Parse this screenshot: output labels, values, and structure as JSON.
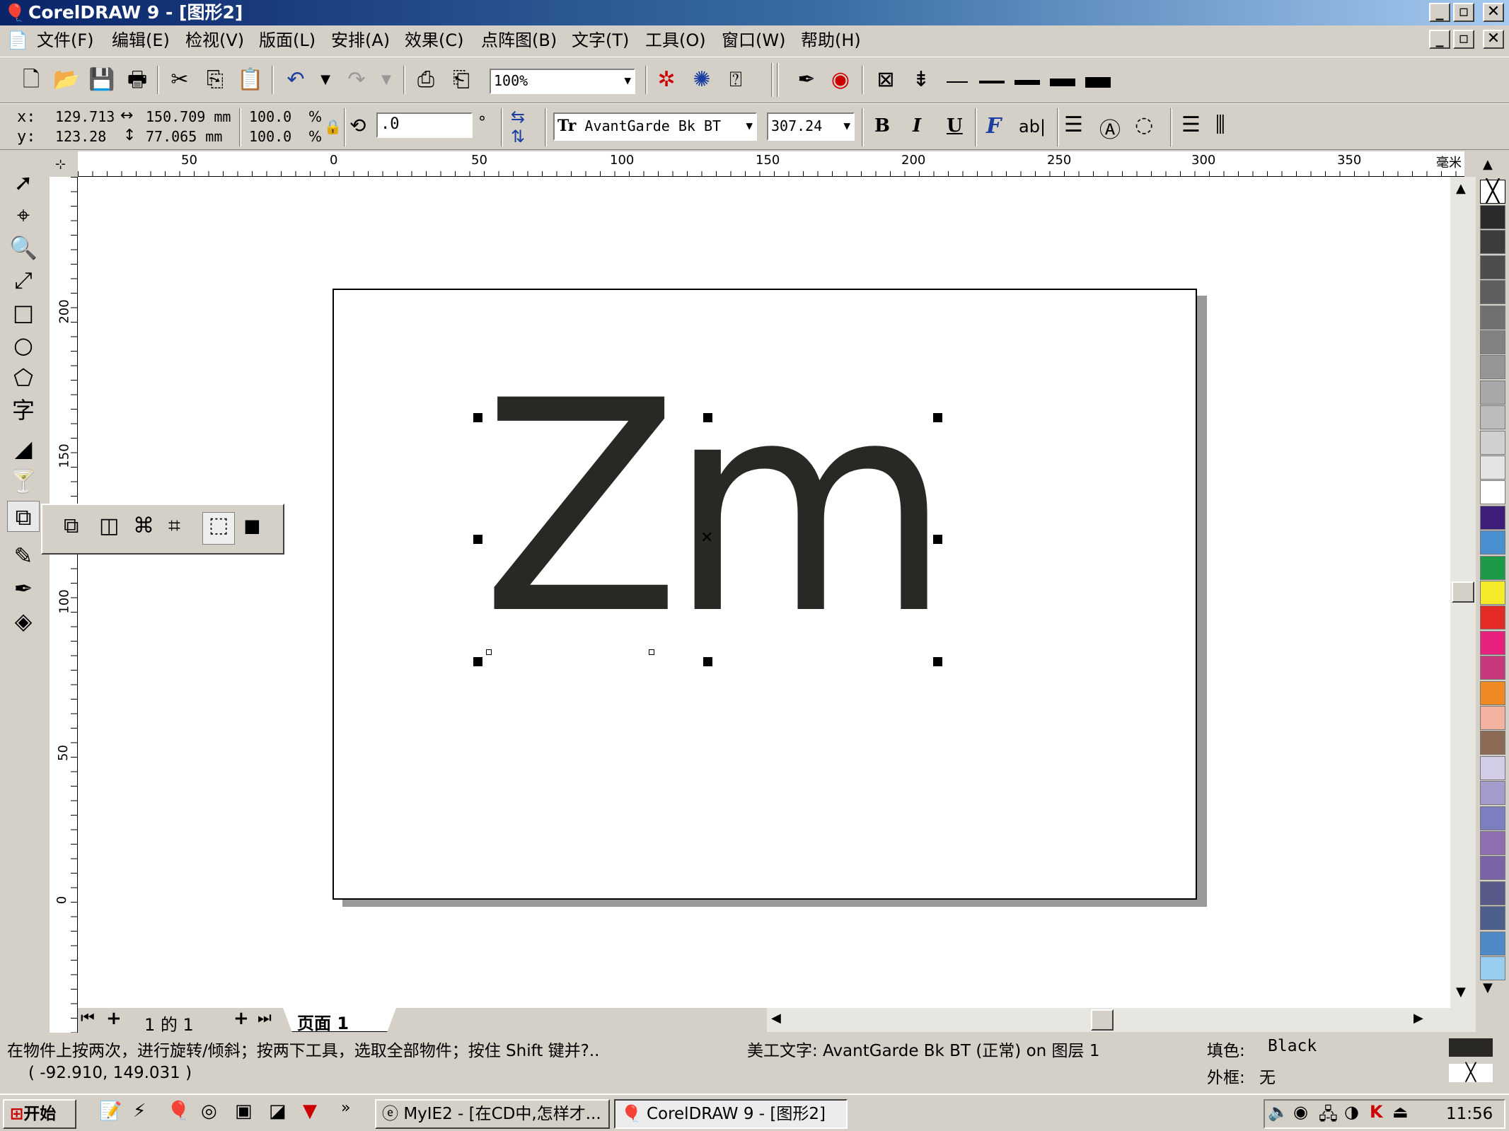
{
  "window": {
    "title": "CorelDRAW 9 - [图形2]"
  },
  "menu": [
    "文件(F)",
    "编辑(E)",
    "检视(V)",
    "版面(L)",
    "安排(A)",
    "效果(C)",
    "点阵图(B)",
    "文字(T)",
    "工具(O)",
    "窗口(W)",
    "帮助(H)"
  ],
  "toolbar": {
    "zoom": "100%"
  },
  "property_bar": {
    "x_label": "x:",
    "y_label": "y:",
    "x": "129.713",
    "y": "123.28",
    "width": "150.709 mm",
    "height": "77.065 mm",
    "scale_x": "100.0",
    "scale_y": "100.0",
    "pct": "%",
    "rotation": ".0",
    "degree": "°",
    "font": "AvantGarde Bk BT",
    "font_size": "307.24",
    "bold": "B",
    "italic": "I",
    "underline": "U"
  },
  "ruler": {
    "unit": "毫米",
    "h_ticks": [
      "50",
      "0",
      "50",
      "100",
      "150",
      "200",
      "250",
      "300",
      "350"
    ],
    "v_ticks": [
      "200",
      "150",
      "100",
      "50",
      "0"
    ]
  },
  "document": {
    "text": "Zm"
  },
  "page_nav": {
    "count": "1 的 1",
    "page_tab": "页面 1"
  },
  "status": {
    "hint": "在物件上按两次，进行旋转/倾斜；按两下工具，选取全部物件；按住 Shift 键并?..",
    "coords": "( -92.910, 149.031 )",
    "object": "美工文字: AvantGarde Bk BT (正常) on 图层 1",
    "fill_label": "填色:",
    "fill_value": "Black",
    "outline_label": "外框:",
    "outline_value": "无"
  },
  "taskbar": {
    "start": "开始",
    "tasks": [
      "MyIE2 - [在CD中,怎样才...",
      "CorelDRAW 9 - [图形2]"
    ],
    "clock": "11:56"
  },
  "colors": {
    "palette": [
      "#2b2b2b",
      "#3c3c3c",
      "#4d4d4d",
      "#5e5e5e",
      "#707070",
      "#828282",
      "#959595",
      "#a8a8a8",
      "#bcbcbc",
      "#d0d0d0",
      "#e4e4e4",
      "#ffffff",
      "#3d1f7a",
      "#4a8fd0",
      "#1c9a48",
      "#f4ea2a",
      "#e42b24",
      "#e6207c",
      "#c8387d",
      "#ef8a22",
      "#f2b3a1",
      "#8c6a56",
      "#d4cde8",
      "#a59bcc",
      "#7b7fbf",
      "#8f6fb2",
      "#7c62a7",
      "#59598a",
      "#4b5f8a",
      "#4f8ac8",
      "#98cdef"
    ]
  }
}
